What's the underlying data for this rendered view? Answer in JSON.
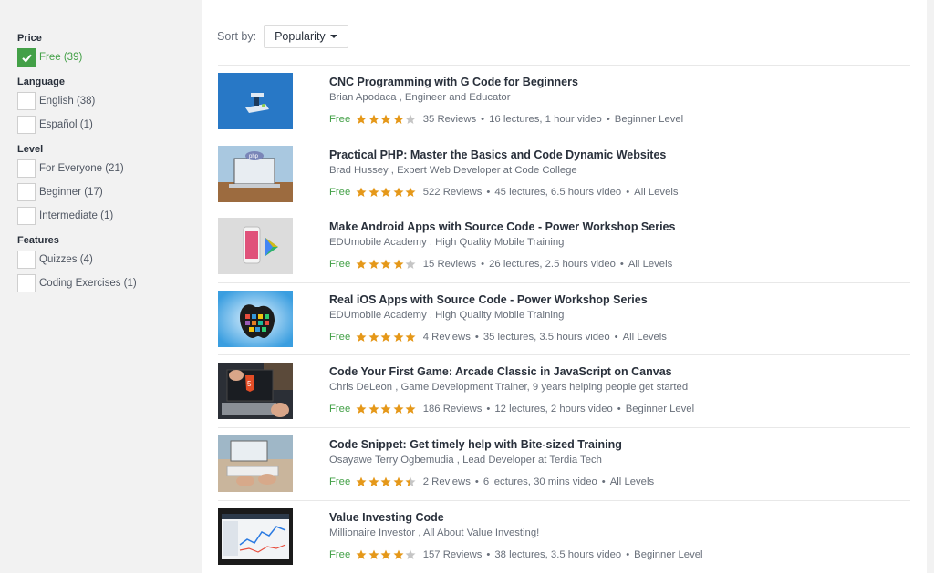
{
  "filters": {
    "price": {
      "title": "Price",
      "options": [
        {
          "label": "Free (39)",
          "checked": true
        }
      ]
    },
    "language": {
      "title": "Language",
      "options": [
        {
          "label": "English (38)"
        },
        {
          "label": "Español (1)"
        }
      ]
    },
    "level": {
      "title": "Level",
      "options": [
        {
          "label": "For Everyone (21)"
        },
        {
          "label": "Beginner (17)"
        },
        {
          "label": "Intermediate (1)"
        }
      ]
    },
    "features": {
      "title": "Features",
      "options": [
        {
          "label": "Quizzes (4)"
        },
        {
          "label": "Coding Exercises (1)"
        }
      ]
    }
  },
  "sort": {
    "label": "Sort by:",
    "value": "Popularity"
  },
  "colors": {
    "accent_green": "#43a047",
    "star": "#e59819",
    "star_empty": "#c5c5c5"
  },
  "courses": [
    {
      "title": "CNC Programming with G Code for Beginners",
      "author": "Brian Apodaca , Engineer and Educator",
      "price": "Free",
      "rating": 4,
      "reviews": "35 Reviews",
      "lectures": "16 lectures, 1 hour video",
      "level": "Beginner Level"
    },
    {
      "title": "Practical PHP: Master the Basics and Code Dynamic Websites",
      "author": "Brad Hussey , Expert Web Developer at Code College",
      "price": "Free",
      "rating": 5,
      "reviews": "522 Reviews",
      "lectures": "45 lectures, 6.5 hours video",
      "level": "All Levels"
    },
    {
      "title": "Make Android Apps with Source Code - Power Workshop Series",
      "author": "EDUmobile Academy , High Quality Mobile Training",
      "price": "Free",
      "rating": 4,
      "reviews": "15 Reviews",
      "lectures": "26 lectures, 2.5 hours video",
      "level": "All Levels"
    },
    {
      "title": "Real iOS Apps with Source Code - Power Workshop Series",
      "author": "EDUmobile Academy , High Quality Mobile Training",
      "price": "Free",
      "rating": 5,
      "reviews": "4 Reviews",
      "lectures": "35 lectures, 3.5 hours video",
      "level": "All Levels"
    },
    {
      "title": "Code Your First Game: Arcade Classic in JavaScript on Canvas",
      "author": "Chris DeLeon , Game Development Trainer, 9 years helping people get started",
      "price": "Free",
      "rating": 5,
      "reviews": "186 Reviews",
      "lectures": "12 lectures, 2 hours video",
      "level": "Beginner Level"
    },
    {
      "title": "Code Snippet: Get timely help with Bite-sized Training",
      "author": "Osayawe Terry Ogbemudia , Lead Developer at Terdia Tech",
      "price": "Free",
      "rating": 4.5,
      "reviews": "2 Reviews",
      "lectures": "6 lectures, 30 mins video",
      "level": "All Levels"
    },
    {
      "title": "Value Investing Code",
      "author": "Millionaire Investor , All About Value Investing!",
      "price": "Free",
      "rating": 4,
      "reviews": "157 Reviews",
      "lectures": "38 lectures, 3.5 hours video",
      "level": "Beginner Level"
    }
  ]
}
